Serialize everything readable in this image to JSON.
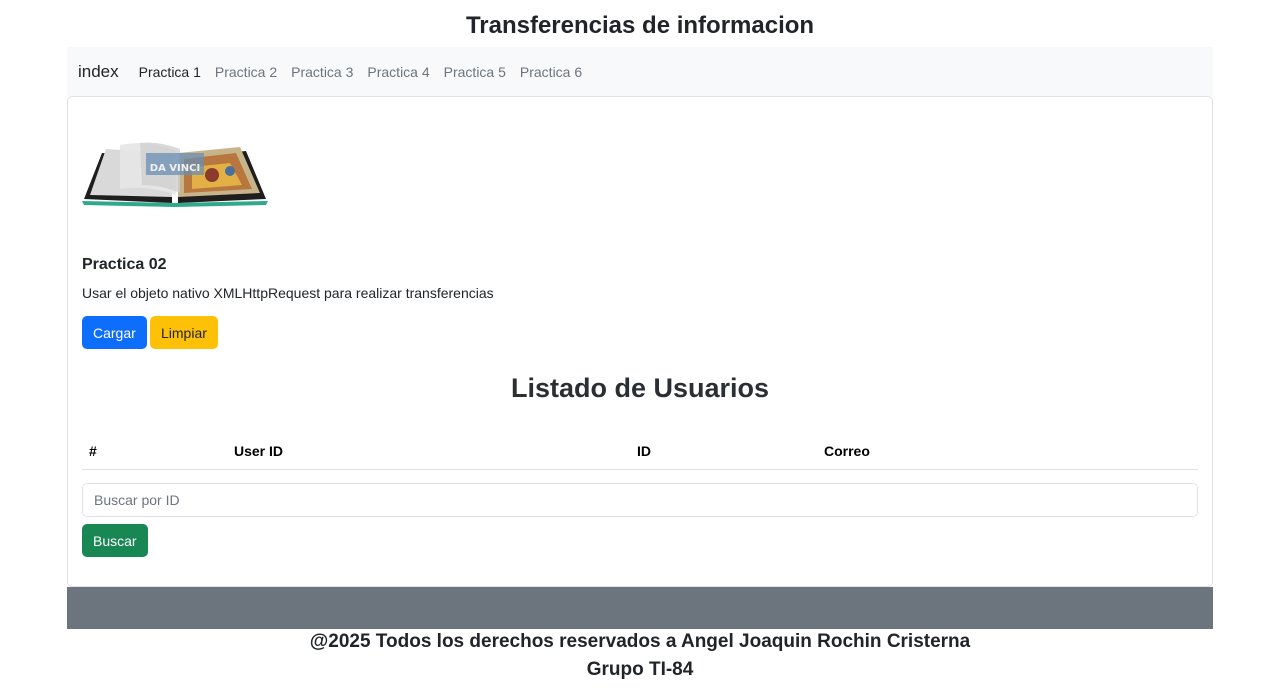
{
  "page": {
    "title": "Transferencias de informacion"
  },
  "navbar": {
    "brand": "index",
    "links": [
      "Practica 1",
      "Practica 2",
      "Practica 3",
      "Practica 4",
      "Practica 5",
      "Practica 6"
    ],
    "active_index": 0
  },
  "card": {
    "logo_icon": "open-book-da-vinci-logo",
    "section_title": "Practica 02",
    "section_desc": "Usar el objeto nativo XMLHttpRequest para realizar transferencias",
    "buttons": {
      "cargar": "Cargar",
      "limpiar": "Limpiar",
      "buscar": "Buscar"
    },
    "list_title": "Listado de Usuarios",
    "table_headers": [
      "#",
      "User ID",
      "ID",
      "Correo"
    ],
    "search": {
      "placeholder": "Buscar por ID",
      "value": ""
    }
  },
  "footer": {
    "line1": "@2025 Todos los derechos reservados a Angel Joaquin Rochin Cristerna",
    "line2": "Grupo TI-84"
  },
  "colors": {
    "primary": "#0d6efd",
    "warning": "#ffc107",
    "success": "#198754",
    "footer_bar": "#6c757d",
    "navbar_bg": "#f8f9fa"
  }
}
